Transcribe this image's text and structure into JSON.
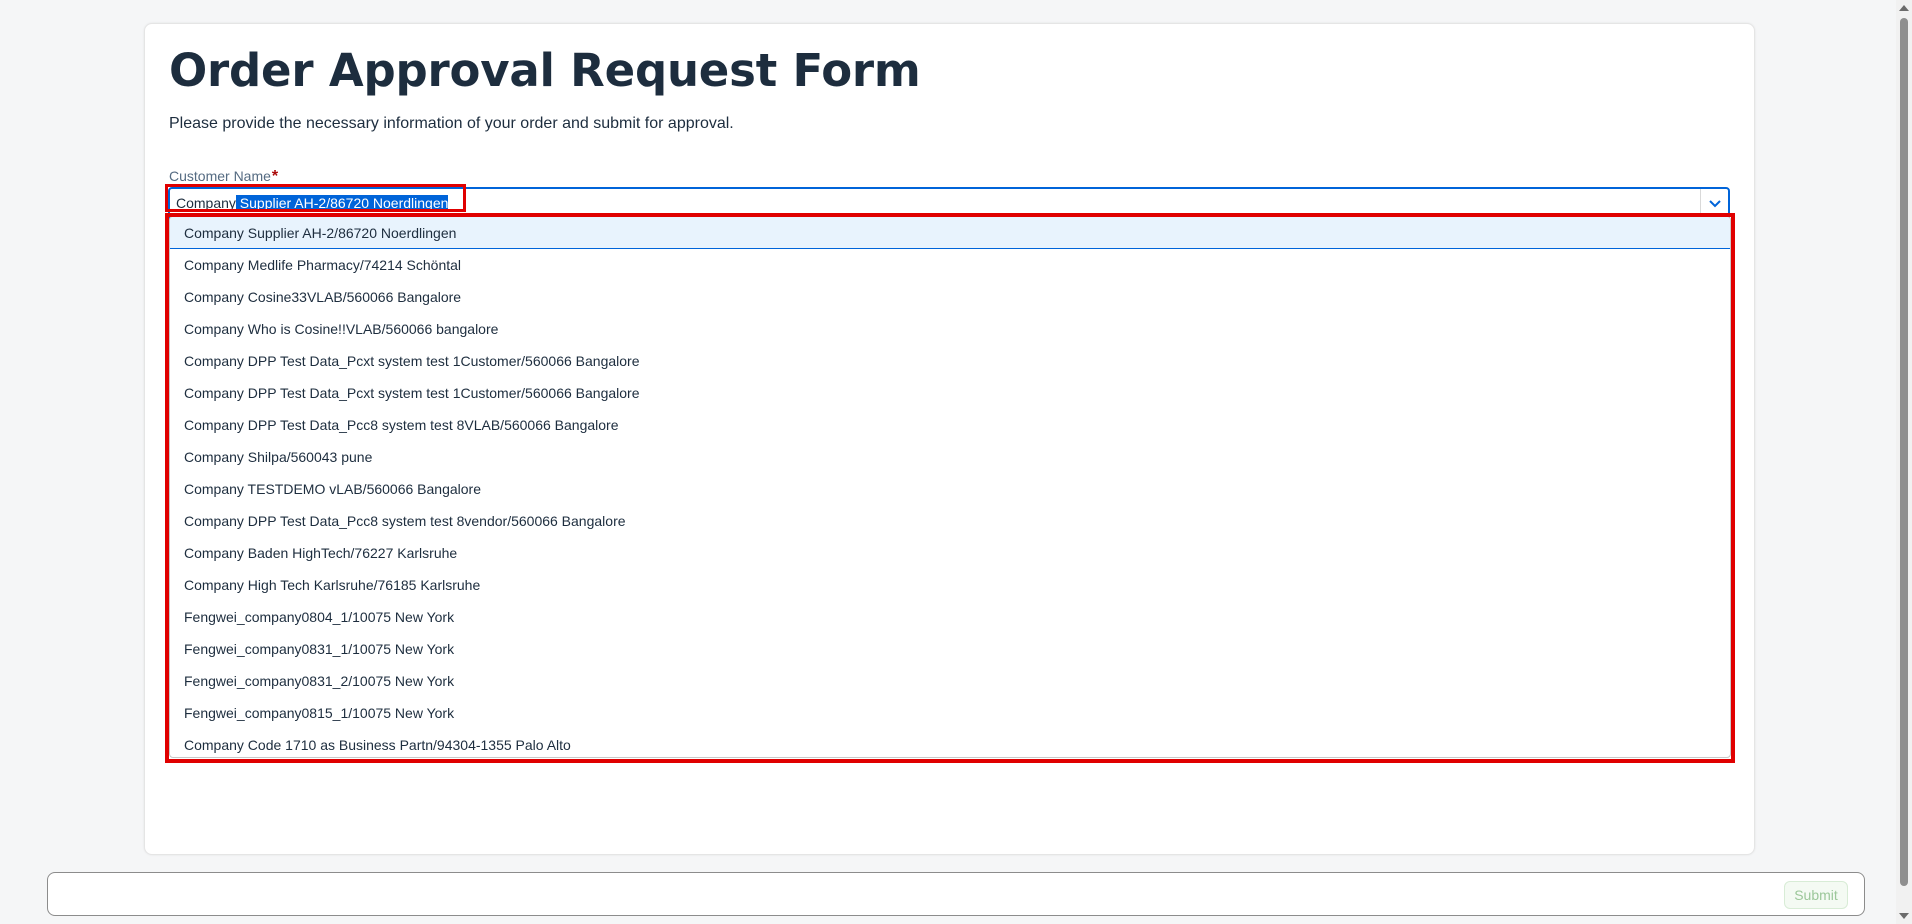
{
  "form": {
    "title": "Order Approval Request Form",
    "subtitle": "Please provide the necessary information of your order and submit for approval.",
    "customer_label": "Customer Name",
    "required_marker": "*",
    "customer_value_typed": "Company",
    "customer_value_selected": " Supplier AH-2/86720 Noerdlingen"
  },
  "dropdown": {
    "options": [
      "Company Supplier AH-2/86720 Noerdlingen",
      "Company Medlife Pharmacy/74214 Schöntal",
      "Company Cosine33VLAB/560066 Bangalore",
      "Company Who is Cosine!!VLAB/560066 bangalore",
      "Company DPP Test Data_Pcxt system test 1Customer/560066 Bangalore",
      "Company DPP Test Data_Pcxt system test 1Customer/560066 Bangalore",
      "Company DPP Test Data_Pcc8 system test 8VLAB/560066 Bangalore",
      "Company Shilpa/560043 pune",
      "Company TESTDEMO vLAB/560066 Bangalore",
      "Company DPP Test Data_Pcc8 system test 8vendor/560066 Bangalore",
      "Company Baden HighTech/76227 Karlsruhe",
      "Company High Tech Karlsruhe/76185 Karlsruhe",
      "Fengwei_company0804_1/10075 New York",
      "Fengwei_company0831_1/10075 New York",
      "Fengwei_company0831_2/10075 New York",
      "Fengwei_company0815_1/10075 New York",
      "Company Code 1710 as Business Partn/94304-1355 Palo Alto"
    ]
  },
  "footer": {
    "submit_label": "Submit"
  },
  "icons": {
    "dropdown_arrow": "chevron-down-icon"
  },
  "colors": {
    "accent": "#0064d9",
    "highlight_box": "#e00000",
    "required": "#aa0808"
  }
}
